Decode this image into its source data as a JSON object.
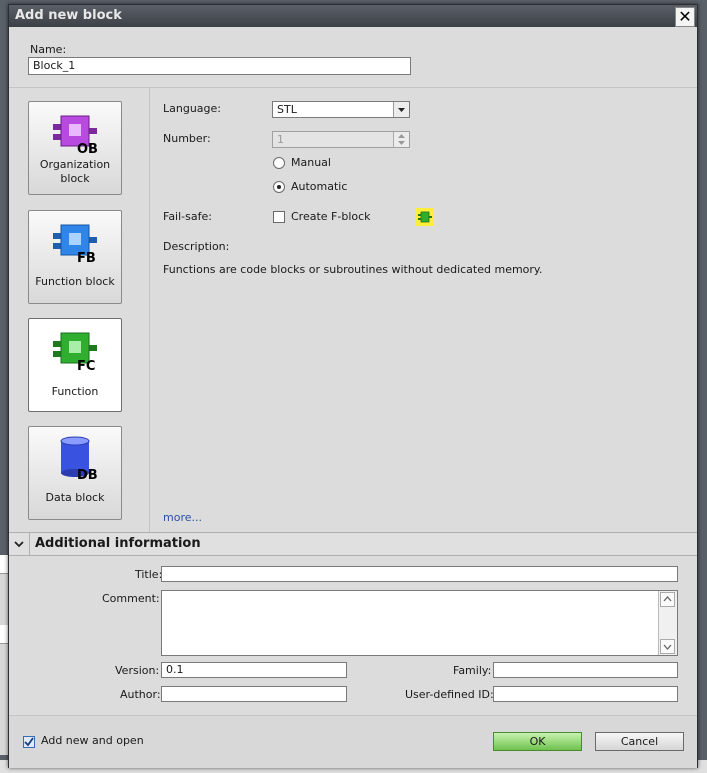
{
  "dialog": {
    "title": "Add new block"
  },
  "name": {
    "label": "Name:",
    "value": "Block_1"
  },
  "block_types": [
    {
      "label": "Organization block",
      "tag": "OB",
      "color": "#b84ae0"
    },
    {
      "label": "Function block",
      "tag": "FB",
      "color": "#2f86e8"
    },
    {
      "label": "Function",
      "tag": "FC",
      "color": "#2fae2f"
    },
    {
      "label": "Data block",
      "tag": "DB",
      "color": "#3a52e0"
    }
  ],
  "props": {
    "language_label": "Language:",
    "language_value": "STL",
    "number_label": "Number:",
    "number_value": "1",
    "manual_label": "Manual",
    "automatic_label": "Automatic",
    "failsafe_label": "Fail-safe:",
    "create_fblock_label": "Create F-block",
    "description_label": "Description:",
    "description_text": "Functions are code blocks or subroutines without dedicated memory.",
    "more_link": "more..."
  },
  "additional": {
    "header": "Additional information",
    "title_label": "Title:",
    "comment_label": "Comment:",
    "version_label": "Version:",
    "version_value": "0.1",
    "author_label": "Author:",
    "family_label": "Family:",
    "user_id_label": "User-defined ID:"
  },
  "footer": {
    "add_open_label": "Add new and open",
    "ok_label": "OK",
    "cancel_label": "Cancel"
  }
}
